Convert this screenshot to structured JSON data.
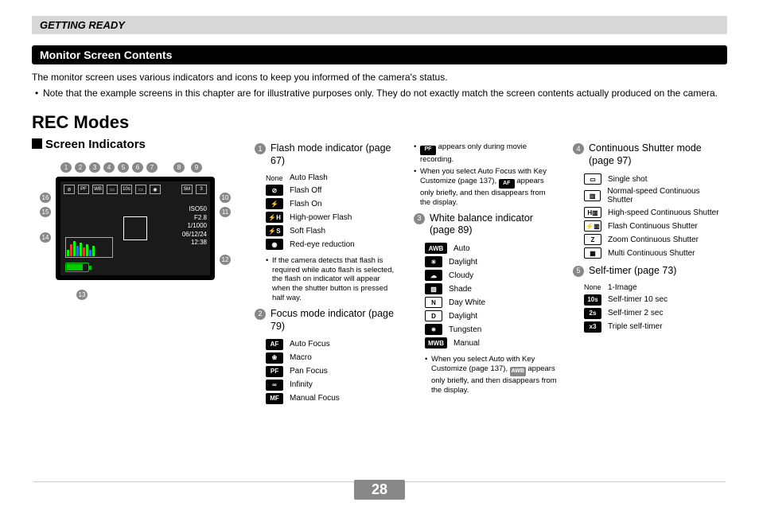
{
  "page": {
    "number": "28",
    "chapter": "GETTING READY"
  },
  "section": {
    "title": "Monitor Screen Contents"
  },
  "intro": {
    "line1": "The monitor screen uses various indicators and icons to keep you informed of the camera's status.",
    "line2": "Note that the example screens in this chapter are for illustrative purposes only. They do not exactly match the screen contents actually produced on the camera."
  },
  "rec_modes": {
    "heading": "REC Modes",
    "subheading": "Screen Indicators"
  },
  "diagram": {
    "callouts": [
      "1",
      "2",
      "3",
      "4",
      "5",
      "6",
      "7",
      "8",
      "9",
      "10",
      "11",
      "12",
      "13",
      "14",
      "15",
      "16"
    ],
    "readout": {
      "iso": "ISO50",
      "f": "F2.8",
      "speed": "1/1000",
      "date": "06/12/24",
      "time": "12:38"
    }
  },
  "cols": {
    "flash": {
      "title": "Flash mode indicator (page 67)",
      "items": [
        {
          "icon": "None",
          "label": "Auto Flash",
          "type": "none"
        },
        {
          "icon": "⊘",
          "label": "Flash Off"
        },
        {
          "icon": "⚡",
          "label": "Flash On"
        },
        {
          "icon": "⚡H",
          "label": "High-power Flash"
        },
        {
          "icon": "⚡S",
          "label": "Soft Flash"
        },
        {
          "icon": "◉",
          "label": "Red-eye reduction"
        }
      ],
      "note": "If the camera detects that flash is required while auto flash is selected, the flash on indicator will appear when the shutter button is pressed half way."
    },
    "focus": {
      "title": "Focus mode indicator (page 79)",
      "items": [
        {
          "icon": "AF",
          "label": "Auto Focus",
          "type": "box"
        },
        {
          "icon": "❀",
          "label": "Macro"
        },
        {
          "icon": "PF",
          "label": "Pan Focus",
          "type": "box"
        },
        {
          "icon": "∞",
          "label": "Infinity"
        },
        {
          "icon": "MF",
          "label": "Manual Focus",
          "type": "box"
        }
      ]
    },
    "note_pf_af": {
      "l1a": " appears only during movie recording.",
      "l2a": "When you select Auto Focus with Key Customize (page 137), ",
      "l2b": " appears only briefly, and then disappears from the display."
    },
    "wb": {
      "title": "White balance indicator (page 89)",
      "items": [
        {
          "icon": "AWB",
          "label": "Auto",
          "type": "box"
        },
        {
          "icon": "☀",
          "label": "Daylight"
        },
        {
          "icon": "☁",
          "label": "Cloudy"
        },
        {
          "icon": "▧",
          "label": "Shade"
        },
        {
          "icon": "N",
          "label": "Day White",
          "type": "outline"
        },
        {
          "icon": "D",
          "label": "Daylight",
          "type": "outline"
        },
        {
          "icon": "✷",
          "label": "Tungsten"
        },
        {
          "icon": "MWB",
          "label": "Manual",
          "type": "box"
        }
      ],
      "note_a": "When you select Auto with Key Customize (page 137), ",
      "note_b": " appears only briefly, and then disappears from the display."
    },
    "cont": {
      "title": "Continuous Shutter mode (page 97)",
      "items": [
        {
          "icon": "▭",
          "label": "Single shot",
          "type": "outline"
        },
        {
          "icon": "▥",
          "label": "Normal-speed Continuous Shutter",
          "type": "outline"
        },
        {
          "icon": "H▥",
          "label": "High-speed Continuous Shutter",
          "type": "outline"
        },
        {
          "icon": "⚡▥",
          "label": "Flash Continuous Shutter",
          "type": "outline"
        },
        {
          "icon": "Z",
          "label": "Zoom Continuous Shutter",
          "type": "outline"
        },
        {
          "icon": "▦",
          "label": "Multi Continuous Shutter",
          "type": "outline"
        }
      ]
    },
    "self": {
      "title": "Self-timer (page 73)",
      "items": [
        {
          "icon": "None",
          "label": "1-Image",
          "type": "none"
        },
        {
          "icon": "10s",
          "label": "Self-timer 10 sec"
        },
        {
          "icon": "2s",
          "label": "Self-timer 2 sec"
        },
        {
          "icon": "x3",
          "label": "Triple self-timer"
        }
      ]
    }
  }
}
